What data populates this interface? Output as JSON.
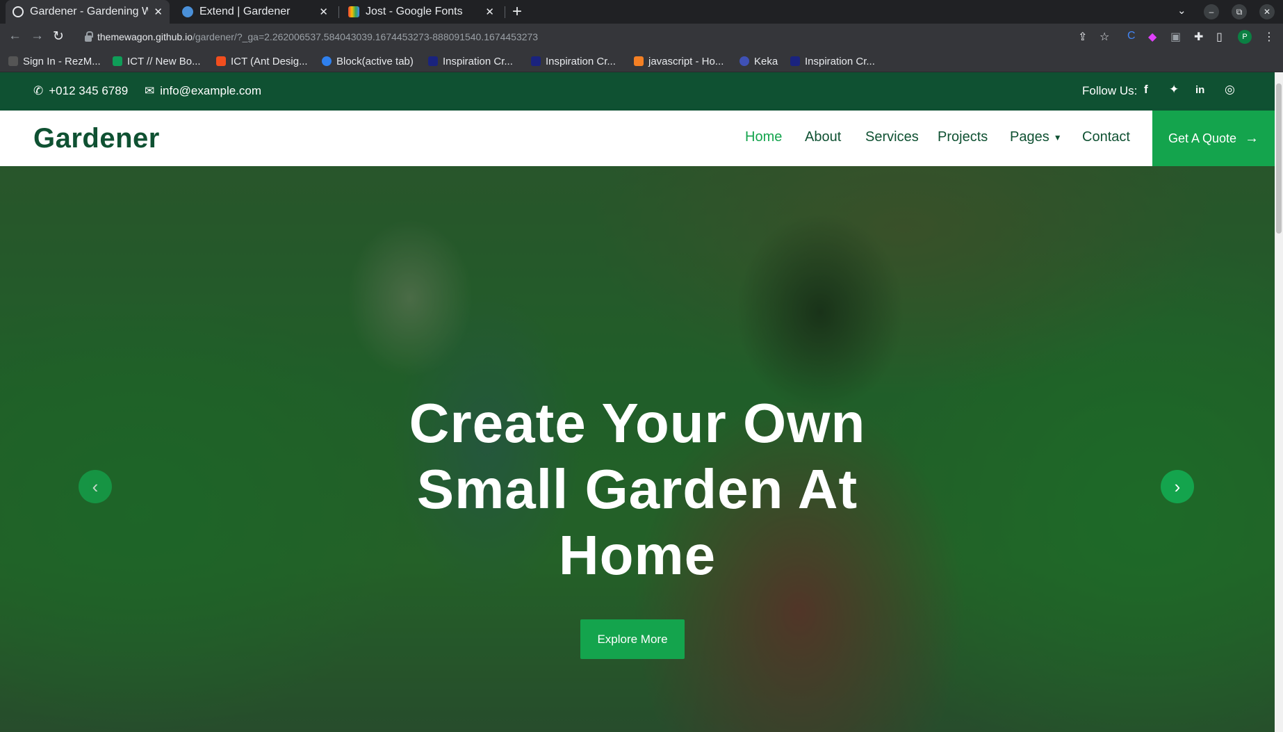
{
  "browser": {
    "tabs": [
      {
        "title": "Gardener - Gardening We",
        "active": true,
        "favicon_color": "#e8eaed"
      },
      {
        "title": "Extend | Gardener",
        "active": false,
        "favicon_color": "#4a90d9"
      },
      {
        "title": "Jost - Google Fonts",
        "active": false,
        "favicon_color": "#ea4335"
      }
    ],
    "close_glyph": "✕",
    "new_tab_glyph": "+",
    "tab_menu_glyph": "⌄",
    "window_controls": [
      "–",
      "⧉",
      "✕"
    ],
    "url_host": "themewagon.github.io",
    "url_path": "/gardener/?_ga=2.262006537.584043039.1674453273-888091540.1674453273",
    "profile_initial": "P",
    "bookmarks": [
      {
        "label": "Sign In - RezM...",
        "color": "#555"
      },
      {
        "label": "ICT // New Bo...",
        "color": "#0f9d58"
      },
      {
        "label": "ICT (Ant Desig...",
        "color": "#f24e1e"
      },
      {
        "label": "Block(active tab)",
        "color": "#2f80ed"
      },
      {
        "label": "Inspiration Cr...",
        "color": "#1a237e"
      },
      {
        "label": "Inspiration Cr...",
        "color": "#1a237e"
      },
      {
        "label": "javascript - Ho...",
        "color": "#f48024"
      },
      {
        "label": "Keka",
        "color": "#3f51b5"
      },
      {
        "label": "Inspiration Cr...",
        "color": "#1a237e"
      }
    ]
  },
  "site": {
    "topbar": {
      "phone": "+012 345 6789",
      "email": "info@example.com",
      "follow_label": "Follow Us:",
      "social": [
        "f",
        "t",
        "in",
        "ig"
      ]
    },
    "brand": "Gardener",
    "menu": [
      {
        "label": "Home",
        "active": true
      },
      {
        "label": "About"
      },
      {
        "label": "Services"
      },
      {
        "label": "Projects"
      },
      {
        "label": "Pages",
        "dropdown": true
      },
      {
        "label": "Contact"
      }
    ],
    "quote_button": "Get A Quote",
    "hero": {
      "title_line1": "Create Your Own",
      "title_line2": "Small Garden At",
      "title_line3": "Home",
      "button": "Explore More"
    },
    "colors": {
      "primary": "#14a44d",
      "dark": "#0f5132"
    }
  }
}
